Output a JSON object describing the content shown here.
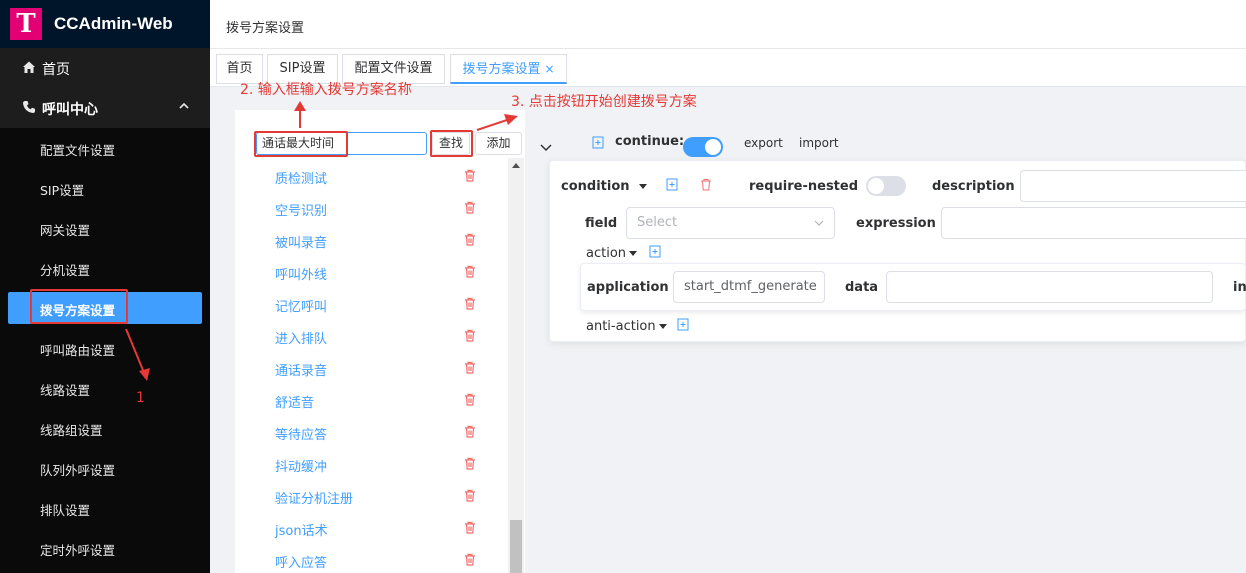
{
  "app": {
    "brand_letter": "T",
    "brand_title": "CCAdmin-Web"
  },
  "sidebar": {
    "home": "首页",
    "group": "呼叫中心",
    "items": [
      "配置文件设置",
      "SIP设置",
      "网关设置",
      "分机设置",
      "拨号方案设置",
      "呼叫路由设置",
      "线路设置",
      "线路组设置",
      "队列外呼设置",
      "排队设置",
      "定时外呼设置"
    ],
    "active_index": 4
  },
  "header": {
    "breadcrumb": "拨号方案设置"
  },
  "tabs": {
    "items": [
      "首页",
      "SIP设置",
      "配置文件设置",
      "拨号方案设置"
    ],
    "active_close": "×"
  },
  "left_panel": {
    "search_value": "通话最大时间",
    "search_button": "查找",
    "add_button": "添加",
    "plans": [
      "质检测试",
      "空号识别",
      "被叫录音",
      "呼叫外线",
      "记忆呼叫",
      "进入排队",
      "通话录音",
      "舒适音",
      "等待应答",
      "抖动缓冲",
      "验证分机注册",
      "json话术",
      "呼入应答"
    ]
  },
  "right_panel": {
    "continue_label": "continue:",
    "continue_on": true,
    "export": "export",
    "import": "import",
    "condition": "condition",
    "require_nested": "require-nested",
    "require_nested_on": false,
    "description": "description",
    "field": "field",
    "field_placeholder": "Select",
    "expression": "expression",
    "action": "action",
    "application": "application",
    "application_value": "start_dtmf_generate",
    "data": "data",
    "cut_label": "in",
    "anti_action": "anti-action"
  },
  "annotations": {
    "step1": "1",
    "step2": "2. 输入框输入拨号方案名称",
    "step3": "3. 点击按钮开始创建拨号方案"
  },
  "colors": {
    "accent": "#409eff",
    "annotation": "#e53935",
    "sidebar_bg": "#1f1f1f",
    "brand_header": "#001529",
    "logo": "#e20074"
  }
}
